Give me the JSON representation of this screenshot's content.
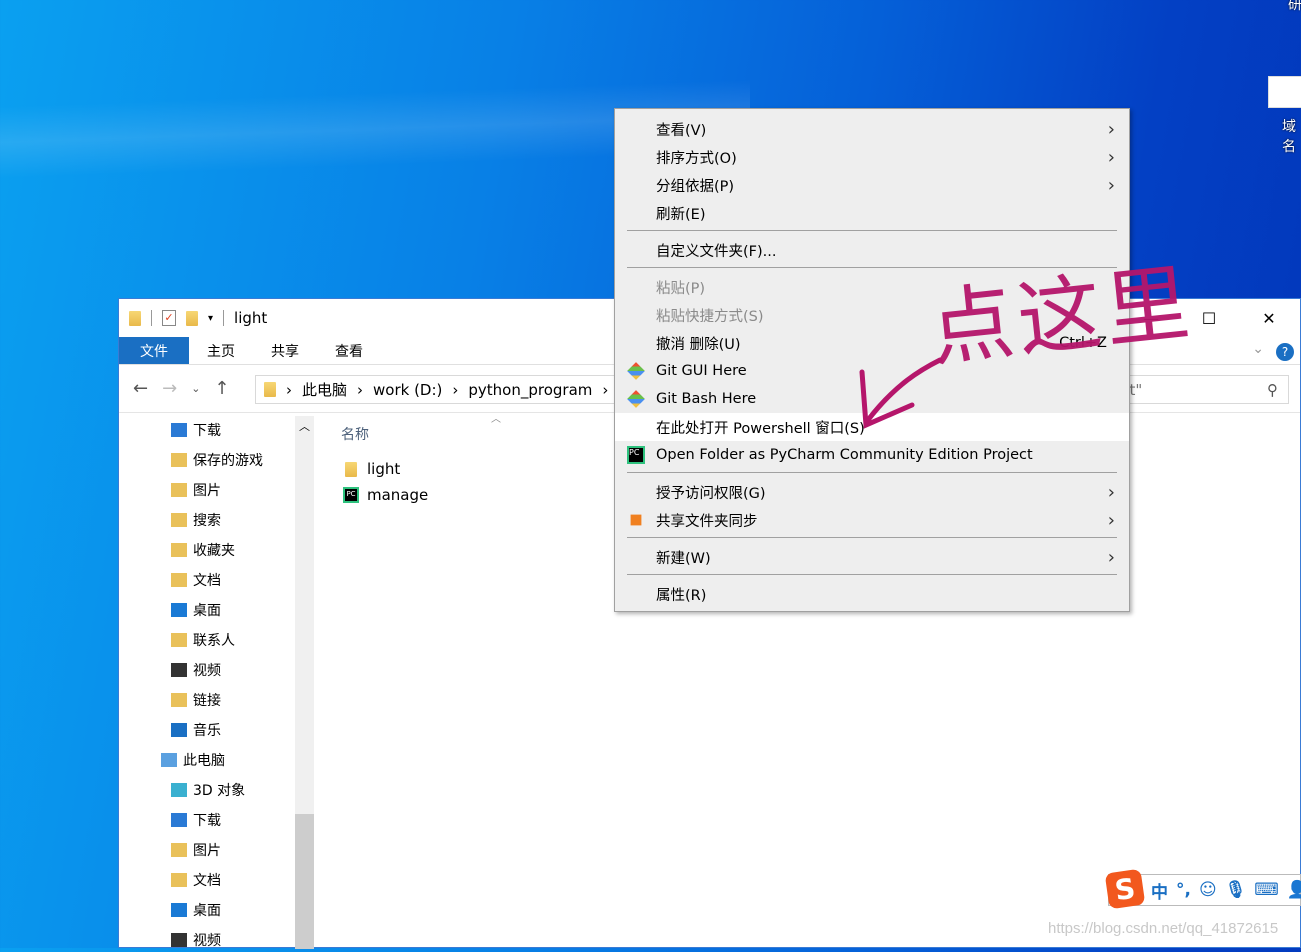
{
  "desktop": {
    "top_label": "研",
    "icon_label": "域名"
  },
  "explorer": {
    "title": "light",
    "ribbon_tabs": [
      "文件",
      "主页",
      "共享",
      "查看"
    ],
    "breadcrumb": [
      "此电脑",
      "work (D:)",
      "python_program"
    ],
    "search_value": "ht\"",
    "nav_items": [
      {
        "label": "下载",
        "icon": "download-icon"
      },
      {
        "label": "保存的游戏",
        "icon": "saved-games-icon"
      },
      {
        "label": "图片",
        "icon": "pictures-icon"
      },
      {
        "label": "搜索",
        "icon": "search-folder-icon"
      },
      {
        "label": "收藏夹",
        "icon": "favorites-icon"
      },
      {
        "label": "文档",
        "icon": "documents-icon"
      },
      {
        "label": "桌面",
        "icon": "desktop-icon"
      },
      {
        "label": "联系人",
        "icon": "contacts-icon"
      },
      {
        "label": "视频",
        "icon": "videos-icon"
      },
      {
        "label": "链接",
        "icon": "links-icon"
      },
      {
        "label": "音乐",
        "icon": "music-icon"
      },
      {
        "label": "此电脑",
        "icon": "this-pc-icon"
      },
      {
        "label": "3D 对象",
        "icon": "3d-objects-icon"
      },
      {
        "label": "下载",
        "icon": "download-icon"
      },
      {
        "label": "图片",
        "icon": "pictures-icon"
      },
      {
        "label": "文档",
        "icon": "documents-icon"
      },
      {
        "label": "桌面",
        "icon": "desktop-icon"
      },
      {
        "label": "视频",
        "icon": "videos-icon"
      }
    ],
    "column_header": "名称",
    "files": [
      {
        "name": "light",
        "icon": "folder-icon"
      },
      {
        "name": "manage",
        "icon": "pycharm-icon"
      }
    ]
  },
  "context_menu": {
    "items": [
      {
        "label": "查看(V)",
        "submenu": true
      },
      {
        "label": "排序方式(O)",
        "submenu": true
      },
      {
        "label": "分组依据(P)",
        "submenu": true
      },
      {
        "label": "刷新(E)"
      },
      {
        "label": "自定义文件夹(F)..."
      },
      {
        "label": "粘贴(P)",
        "disabled": true
      },
      {
        "label": "粘贴快捷方式(S)",
        "disabled": true
      },
      {
        "label": "撤消 删除(U)",
        "shortcut": "Ctrl+Z"
      },
      {
        "label": "Git GUI Here",
        "icon": "git-icon"
      },
      {
        "label": "Git Bash Here",
        "icon": "git-icon"
      },
      {
        "label": "在此处打开 Powershell 窗口(S)",
        "highlighted": true
      },
      {
        "label": "Open Folder as PyCharm Community Edition Project",
        "icon": "pycharm-icon"
      },
      {
        "label": "授予访问权限(G)",
        "submenu": true
      },
      {
        "label": "共享文件夹同步",
        "submenu": true,
        "icon": "sync-icon"
      },
      {
        "label": "新建(W)",
        "submenu": true
      },
      {
        "label": "属性(R)"
      }
    ]
  },
  "annotation": {
    "text": "点这里",
    "color": "#b5166b"
  },
  "ime": {
    "mode": "中",
    "punct": "°,"
  },
  "watermark": "https://blog.csdn.net/qq_41872615",
  "colors": {
    "accent": "#1a6fc3",
    "annotation": "#b5166b",
    "menu_bg": "#eeeeee"
  }
}
